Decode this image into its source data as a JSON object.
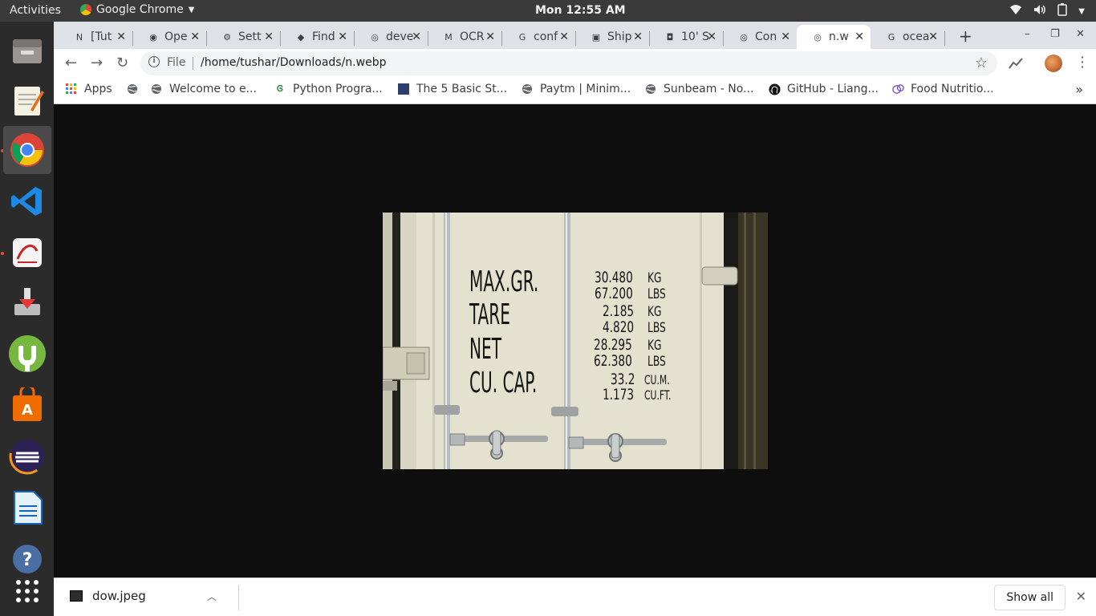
{
  "topbar": {
    "activities": "Activities",
    "app_name": "Google Chrome",
    "clock": "Mon 12:55 AM"
  },
  "dock": {
    "items": [
      "file-manager-icon",
      "text-editor-icon",
      "chrome-icon",
      "vscode-icon",
      "document-viewer-icon",
      "installer-icon",
      "utorrent-icon",
      "software-center-icon",
      "eclipse-icon",
      "writer-icon",
      "help-icon",
      "app-grid-icon"
    ]
  },
  "tabs": [
    {
      "label": "[Tut",
      "icon": "N"
    },
    {
      "label": "Ope",
      "icon": "◉"
    },
    {
      "label": "Sett",
      "icon": "⚙"
    },
    {
      "label": "Find",
      "icon": "◆"
    },
    {
      "label": "deve",
      "icon": "◎"
    },
    {
      "label": "OCR",
      "icon": "M"
    },
    {
      "label": "conf",
      "icon": "G"
    },
    {
      "label": "Ship",
      "icon": "▣"
    },
    {
      "label": "10' S",
      "icon": "◘"
    },
    {
      "label": "Con",
      "icon": "◎"
    },
    {
      "label": "n.w",
      "icon": "◎",
      "active": true
    },
    {
      "label": "ocea",
      "icon": "G"
    }
  ],
  "toolbar": {
    "scheme": "File",
    "url": "/home/tushar/Downloads/n.webp"
  },
  "bookmarks": [
    {
      "label": "Apps",
      "icon": "apps-grid-icon"
    },
    {
      "label": "",
      "icon": "globe-icon"
    },
    {
      "label": "Welcome to e...",
      "icon": "globe-icon"
    },
    {
      "label": "Python Progra...",
      "icon": "gfg-icon"
    },
    {
      "label": "The 5 Basic St...",
      "icon": "page-icon"
    },
    {
      "label": "Paytm | Minim...",
      "icon": "globe-icon"
    },
    {
      "label": "Sunbeam - No...",
      "icon": "globe-icon"
    },
    {
      "label": "GitHub - Liang...",
      "icon": "github-icon"
    },
    {
      "label": "Food Nutritio...",
      "icon": "food-icon"
    }
  ],
  "photo": {
    "rows": [
      {
        "label": "MAX.GR.",
        "v1": "30.480",
        "u1": "KG",
        "v2": "67.200",
        "u2": "LBS"
      },
      {
        "label": "TARE",
        "v1": "2.185",
        "u1": "KG",
        "v2": "4.820",
        "u2": "LBS"
      },
      {
        "label": "NET",
        "v1": "28.295",
        "u1": "KG",
        "v2": "62.380",
        "u2": "LBS"
      },
      {
        "label": "CU. CAP.",
        "v1": "33.2",
        "u1": "CU.M.",
        "v2": "1.173",
        "u2": "CU.FT."
      }
    ]
  },
  "shelf": {
    "file_name": "dow.jpeg",
    "show_all": "Show all"
  }
}
